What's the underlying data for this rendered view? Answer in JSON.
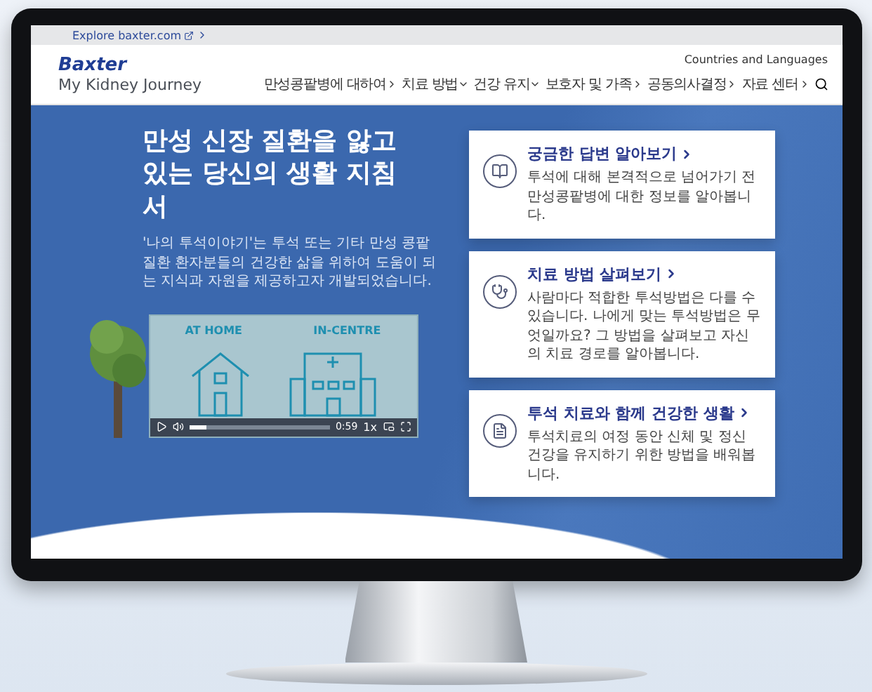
{
  "top_bar": {
    "link": "Explore baxter.com"
  },
  "header": {
    "brand": "Baxter",
    "site_title": "My Kidney Journey",
    "utility_link": "Countries and Languages",
    "nav": [
      {
        "label": "만성콩팥병에 대하여",
        "kind": "link"
      },
      {
        "label": "치료 방법",
        "kind": "dropdown"
      },
      {
        "label": "건강 유지",
        "kind": "dropdown"
      },
      {
        "label": "보호자 및 가족",
        "kind": "link"
      },
      {
        "label": "공동의사결정",
        "kind": "link"
      },
      {
        "label": "자료 센터",
        "kind": "link"
      }
    ]
  },
  "hero": {
    "title": "만성 신장 질환을 앓고 있는 당신의 생활 지침서",
    "subtitle": "'나의 투석이야기'는 투석 또는 기타 만성 콩팥 질환 환자분들의 건강한 삶을 위하여 도움이 되는 지식과 자원을 제공하고자 개발되었습니다.",
    "video": {
      "labels": [
        "AT HOME",
        "IN-CENTRE"
      ],
      "time": "0:59",
      "speed": "1x",
      "level": 0.12
    },
    "cards": [
      {
        "kind": "book",
        "title": "궁금한 답변 알아보기",
        "text": "투석에 대해 본격적으로 넘어가기 전 만성콩팥병에 대한 정보를 알아봅니다."
      },
      {
        "kind": "stethoscope",
        "title": "치료 방법 살펴보기",
        "text": "사람마다 적합한 투석방법은 다를 수 있습니다. 나에게 맞는 투석방법은 무엇일까요? 그 방법을 살펴보고 자신의 치료 경로를 알아봅니다."
      },
      {
        "kind": "document",
        "title": "투석 치료와 함께 건강한 생활",
        "text": "투석치료의 여정 동안 신체 및 정신 건강을 유지하기 위한 방법을 배워봅니다."
      }
    ]
  }
}
